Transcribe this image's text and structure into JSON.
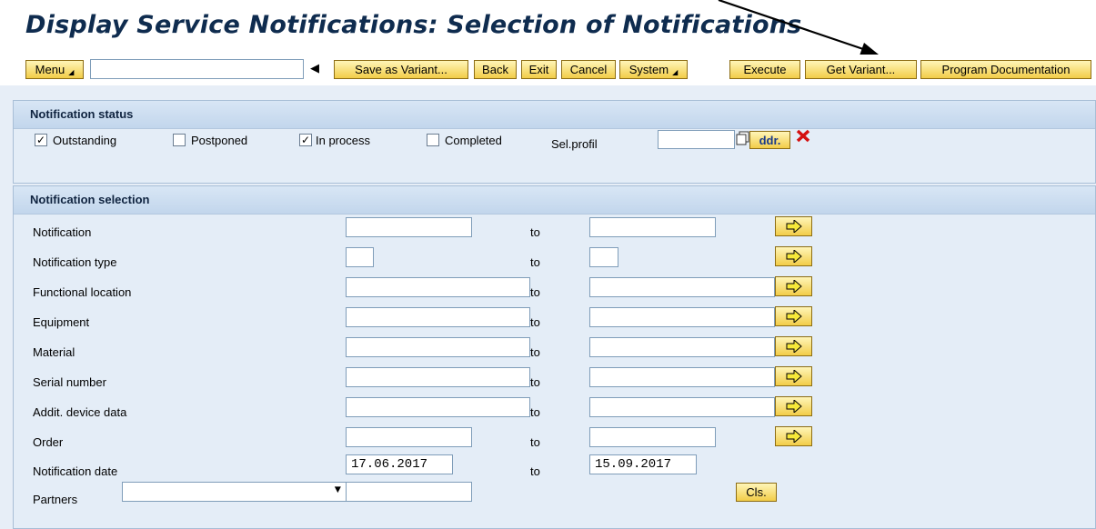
{
  "page": {
    "title": "Display Service Notifications: Selection of Notifications"
  },
  "toolbar": {
    "menu_label": "Menu",
    "command_field_value": "",
    "buttons": {
      "save_as_variant": "Save as Variant...",
      "back": "Back",
      "exit": "Exit",
      "cancel": "Cancel",
      "system": "System",
      "execute": "Execute",
      "get_variant": "Get Variant...",
      "program_documentation": "Program Documentation"
    }
  },
  "notification_status": {
    "title": "Notification status",
    "checkboxes": [
      {
        "label": "Outstanding",
        "checked": true
      },
      {
        "label": "Postponed",
        "checked": false
      },
      {
        "label": "In process",
        "checked": true
      },
      {
        "label": "Completed",
        "checked": false
      }
    ],
    "sel_profil_label": "Sel.profil",
    "sel_profil_value": "",
    "ddr_label": "ddr."
  },
  "notification_selection": {
    "title": "Notification selection",
    "to_label": "to",
    "rows": [
      {
        "label": "Notification",
        "from": "",
        "to": ""
      },
      {
        "label": "Notification type",
        "from": "",
        "to": ""
      },
      {
        "label": "Functional location",
        "from": "",
        "to": ""
      },
      {
        "label": "Equipment",
        "from": "",
        "to": ""
      },
      {
        "label": "Material",
        "from": "",
        "to": ""
      },
      {
        "label": "Serial number",
        "from": "",
        "to": ""
      },
      {
        "label": "Addit. device data",
        "from": "",
        "to": ""
      },
      {
        "label": "Order",
        "from": "",
        "to": ""
      },
      {
        "label": "Notification date",
        "from": "17.06.2017",
        "to": "15.09.2017"
      }
    ],
    "partners_label": "Partners",
    "partners_select_value": "",
    "partners_value": "",
    "cls_label": "Cls."
  },
  "colors": {
    "button_yellow": "#f2cd48",
    "title_blue": "#0f2c4f",
    "frame_header": "#c2d6ec"
  }
}
